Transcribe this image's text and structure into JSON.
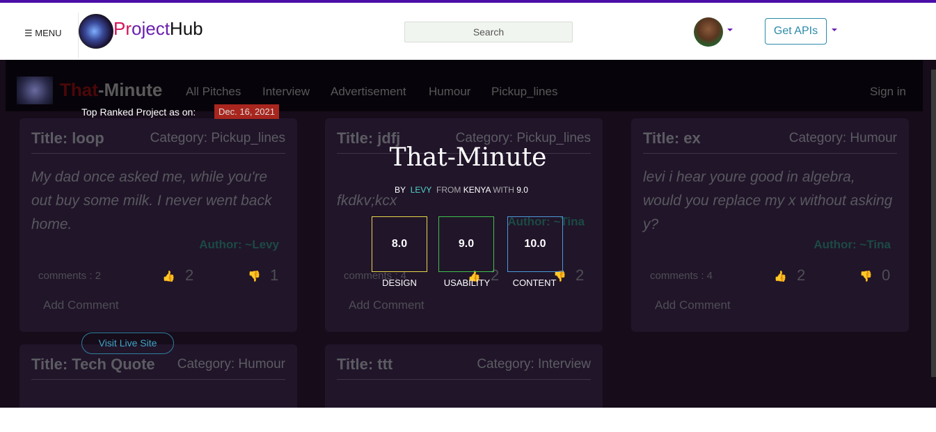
{
  "header": {
    "menu_label": "☰ MENU",
    "brand": {
      "part1": "Pr",
      "part2": "oject",
      "part3": "Hub"
    },
    "search_placeholder": "Search",
    "api_button": "Get APIs"
  },
  "background_site": {
    "brand": {
      "part1": "That",
      "part2": "-Minute"
    },
    "nav_links": [
      "All Pitches",
      "Interview",
      "Advertisement",
      "Humour",
      "Pickup_lines"
    ],
    "sign_in": "Sign in",
    "cards": [
      {
        "title": "Title: loop",
        "category": "Category: Pickup_lines",
        "body": "My dad once asked me, while you're out buy some milk. I never went back home.",
        "author": "Author: ~Levy",
        "comments": "comments : 2",
        "up": "2",
        "down": "1",
        "add": "Add Comment"
      },
      {
        "title": "Title: jdfj",
        "category": "Category: Pickup_lines",
        "body": "fkdkv;kcx",
        "author": "Author: ~Tina",
        "comments": "comments : 4",
        "up": "2",
        "down": "2",
        "add": "Add Comment"
      },
      {
        "title": "Title: ex",
        "category": "Category: Humour",
        "body": "levi i hear youre good in algebra, would you replace my x without asking y?",
        "author": "Author: ~Tina",
        "comments": "comments : 4",
        "up": "2",
        "down": "0",
        "add": "Add Comment"
      },
      {
        "title": "Title: Tech Quote",
        "category": "Category: Humour"
      },
      {
        "title": "Title: ttt",
        "category": "Category: Interview"
      }
    ]
  },
  "overlay": {
    "top_ranked_label": "Top Ranked Project as on:",
    "date": "Dec. 16, 2021",
    "project_title": "That-Minute",
    "by_label": "BY",
    "author": "LEVY",
    "from_label": "FROM",
    "country": "KENYA",
    "with_label": "WITH",
    "overall": "9.0",
    "scores": [
      {
        "value": "8.0",
        "label": "DESIGN",
        "color": "#e8d84a"
      },
      {
        "value": "9.0",
        "label": "USABILITY",
        "color": "#3fc24a"
      },
      {
        "value": "10.0",
        "label": "CONTENT",
        "color": "#4a9ad8"
      }
    ],
    "visit_button": "Visit Live Site"
  }
}
